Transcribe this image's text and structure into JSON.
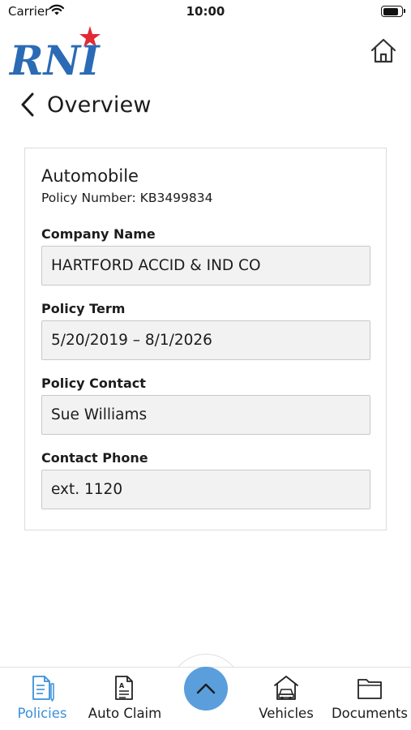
{
  "status_bar": {
    "carrier": "Carrier",
    "time": "10:00",
    "battery_level": 0.9
  },
  "header": {
    "logo_text": "RNI",
    "logo_colors": {
      "blue": "#2b6bb5",
      "red": "#e02b35"
    },
    "home_icon": "home-icon"
  },
  "nav": {
    "back_icon": "chevron-left-icon",
    "title": "Overview"
  },
  "policy": {
    "type": "Automobile",
    "number_line": "Policy Number: KB3499834",
    "fields": [
      {
        "label": "Company Name",
        "value": "HARTFORD ACCID & IND CO"
      },
      {
        "label": "Policy Term",
        "value": "5/20/2019 – 8/1/2026"
      },
      {
        "label": "Policy Contact",
        "value": "Sue Williams"
      },
      {
        "label": "Contact Phone",
        "value": "ext. 1120"
      }
    ]
  },
  "tab_bar": {
    "tabs": [
      {
        "label": "Policies",
        "icon": "policies-document-icon",
        "active": true
      },
      {
        "label": "Auto Claim",
        "icon": "auto-claim-form-icon",
        "active": false
      },
      {
        "label": "Vehicles",
        "icon": "vehicles-garage-icon",
        "active": false
      },
      {
        "label": "Documents",
        "icon": "documents-folder-icon",
        "active": false
      }
    ],
    "center_button_icon": "chevron-up-icon"
  },
  "colors": {
    "accent": "#3a8fd9",
    "fab": "#5a9edc",
    "field_background": "#f2f2f2"
  }
}
